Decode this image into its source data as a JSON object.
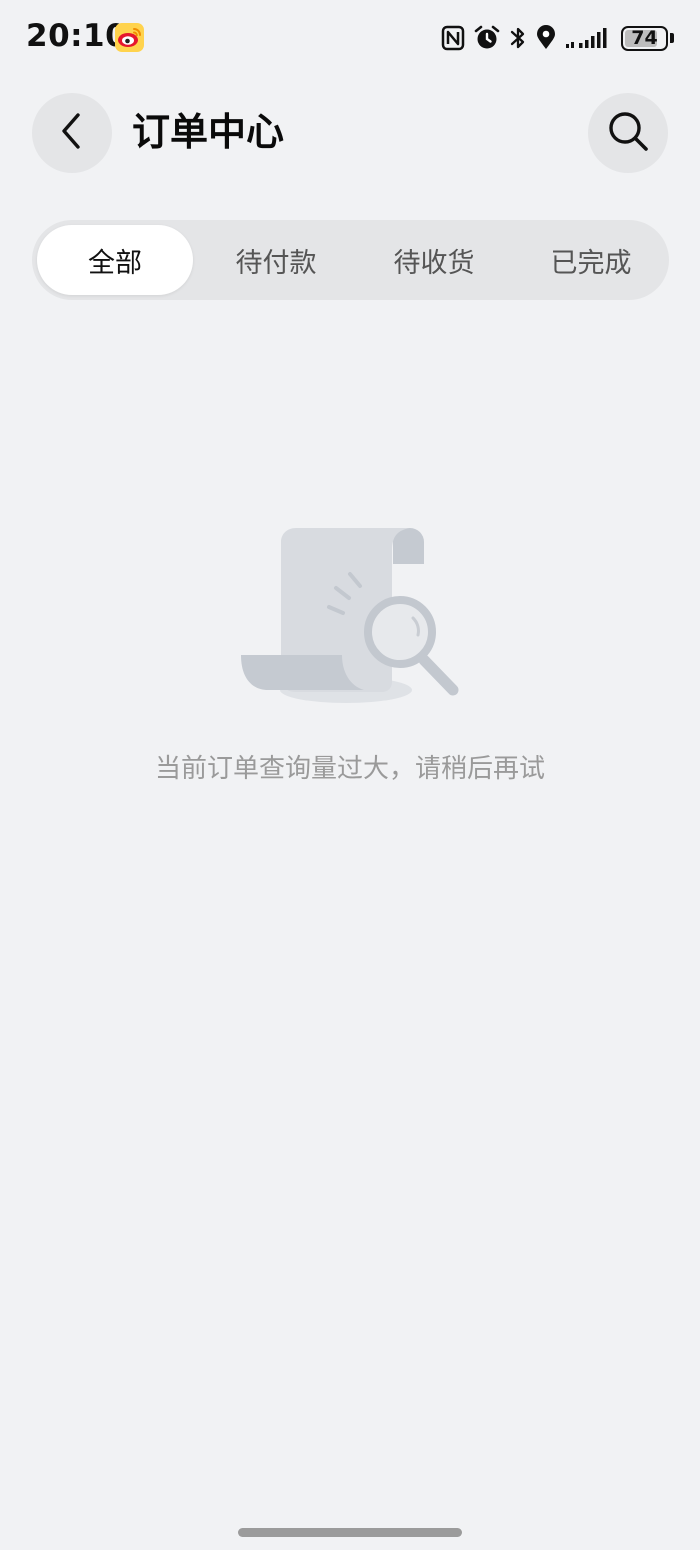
{
  "status_bar": {
    "time": "20:10",
    "app_icon": "weibo-icon",
    "icons": [
      "nfc-icon",
      "alarm-icon",
      "bluetooth-icon",
      "location-icon",
      "signal-icon",
      "battery-icon"
    ],
    "battery_level": "74"
  },
  "header": {
    "title": "订单中心",
    "back_icon": "chevron-left-icon",
    "search_icon": "search-icon"
  },
  "tabs": [
    {
      "label": "全部",
      "active": true
    },
    {
      "label": "待付款",
      "active": false
    },
    {
      "label": "待收货",
      "active": false
    },
    {
      "label": "已完成",
      "active": false
    }
  ],
  "empty_state": {
    "illustration": "document-search-icon",
    "message": "当前订单查询量过大，请稍后再试"
  },
  "colors": {
    "background": "#f1f2f4",
    "tab_track": "#e4e5e7",
    "active_tab": "#ffffff",
    "illustration": "#cfd3d9"
  }
}
